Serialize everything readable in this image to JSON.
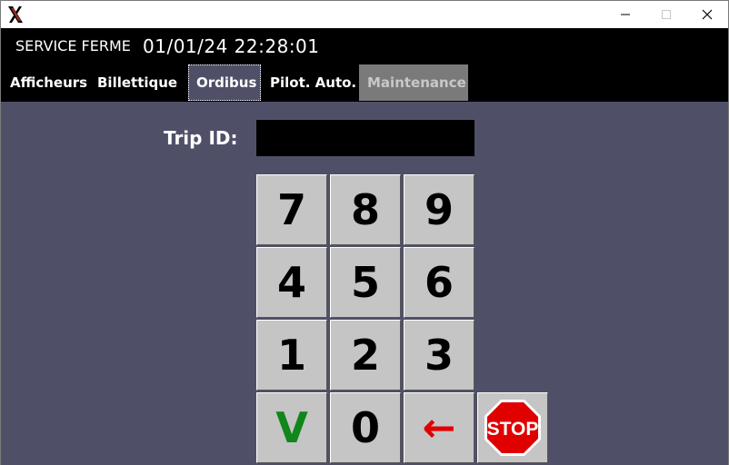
{
  "window": {
    "title_icon": "x-logo-icon",
    "controls": [
      "minimize-icon",
      "maximize-icon",
      "close-icon"
    ]
  },
  "header": {
    "service_state": "SERVICE FERME",
    "datetime": "01/01/24 22:28:01"
  },
  "tabs": [
    {
      "label": "Afficheurs",
      "active": false,
      "enabled": true
    },
    {
      "label": "Billettique",
      "active": false,
      "enabled": true
    },
    {
      "label": "Ordibus",
      "active": true,
      "enabled": true
    },
    {
      "label": "Pilot. Auto.",
      "active": false,
      "enabled": true
    },
    {
      "label": "Maintenance",
      "active": false,
      "enabled": false
    }
  ],
  "form": {
    "trip_label": "Trip ID:",
    "trip_value": ""
  },
  "keypad": {
    "keys": [
      "7",
      "8",
      "9",
      "4",
      "5",
      "6",
      "1",
      "2",
      "3",
      "V",
      "0",
      "←"
    ],
    "stop_label": "STOP"
  },
  "colors": {
    "background": "#4f5068",
    "header": "#000000",
    "key_face": "#c5c5c5",
    "valid": "#11861a",
    "back": "#e00000",
    "stop": "#e00000",
    "tab_disabled": "#7a7a7a"
  }
}
